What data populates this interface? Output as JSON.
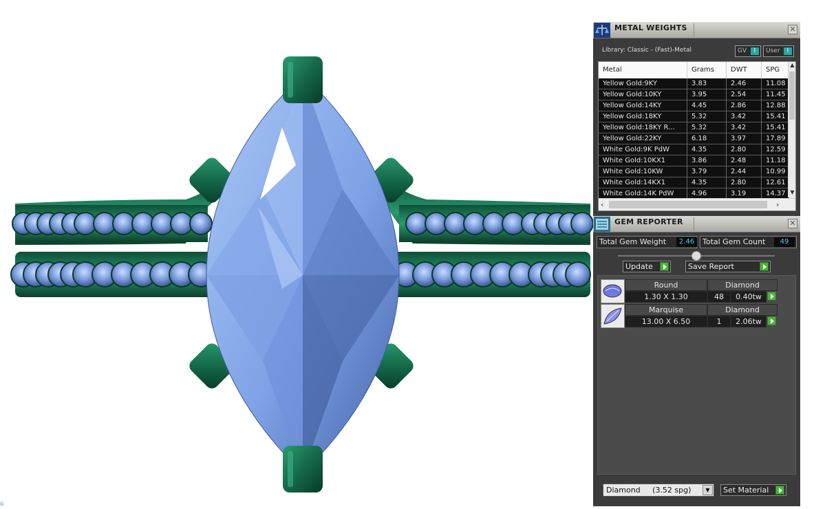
{
  "metal_weights": {
    "title": "METAL WEIGHTS",
    "library_label": "Library: Classic - (Fast)-Metal",
    "toggle_gv": "GV",
    "toggle_user": "User",
    "toggle_indicator": "I",
    "columns": [
      "Metal",
      "Grams",
      "DWT",
      "SPG"
    ],
    "rows": [
      {
        "metal": "Yellow Gold:9KY",
        "grams": "3.83",
        "dwt": "2.46",
        "spg": "11.08"
      },
      {
        "metal": "Yellow Gold:10KY",
        "grams": "3.95",
        "dwt": "2.54",
        "spg": "11.45"
      },
      {
        "metal": "Yellow Gold:14KY",
        "grams": "4.45",
        "dwt": "2.86",
        "spg": "12.88"
      },
      {
        "metal": "Yellow Gold:18KY",
        "grams": "5.32",
        "dwt": "3.42",
        "spg": "15.41"
      },
      {
        "metal": "Yellow Gold:18KY R...",
        "grams": "5.32",
        "dwt": "3.42",
        "spg": "15.41"
      },
      {
        "metal": "Yellow Gold:22KY",
        "grams": "6.18",
        "dwt": "3.97",
        "spg": "17.89"
      },
      {
        "metal": "White Gold:9K PdW",
        "grams": "4.35",
        "dwt": "2.80",
        "spg": "12.59"
      },
      {
        "metal": "White Gold:10KX1",
        "grams": "3.86",
        "dwt": "2.48",
        "spg": "11.18"
      },
      {
        "metal": "White Gold:10KW",
        "grams": "3.79",
        "dwt": "2.44",
        "spg": "10.99"
      },
      {
        "metal": "White Gold:14KX1",
        "grams": "4.35",
        "dwt": "2.80",
        "spg": "12.61"
      },
      {
        "metal": "White Gold:14K PdW",
        "grams": "4.96",
        "dwt": "3.19",
        "spg": "14.37"
      }
    ],
    "close": "✕"
  },
  "gem_reporter": {
    "title": "GEM REPORTER",
    "total_weight_label": "Total Gem Weight",
    "total_weight_value": "2.46",
    "total_count_label": "Total Gem Count",
    "total_count_value": "49",
    "update_label": "Update",
    "save_report_label": "Save Report",
    "gems": [
      {
        "shape": "Round",
        "size": "1.30 X 1.30",
        "material": "Diamond",
        "count": "48",
        "weight": "0.40tw"
      },
      {
        "shape": "Marquise",
        "size": "13.00 X 6.50",
        "material": "Diamond",
        "count": "1",
        "weight": "2.06tw"
      }
    ],
    "material_select": "Diamond     (3.52 spg)",
    "set_material_label": "Set Material",
    "close": "✕"
  },
  "colors": {
    "gem_blue": "#7fa6e8",
    "metal_green": "#14694a",
    "panel_bg": "#3b3b3b",
    "accent_green": "#4bb33a",
    "value_cyan": "#46d0e0"
  },
  "viewport": {
    "ring_band_stones": 48,
    "center_stone": "marquise"
  },
  "side_marker": "ü"
}
